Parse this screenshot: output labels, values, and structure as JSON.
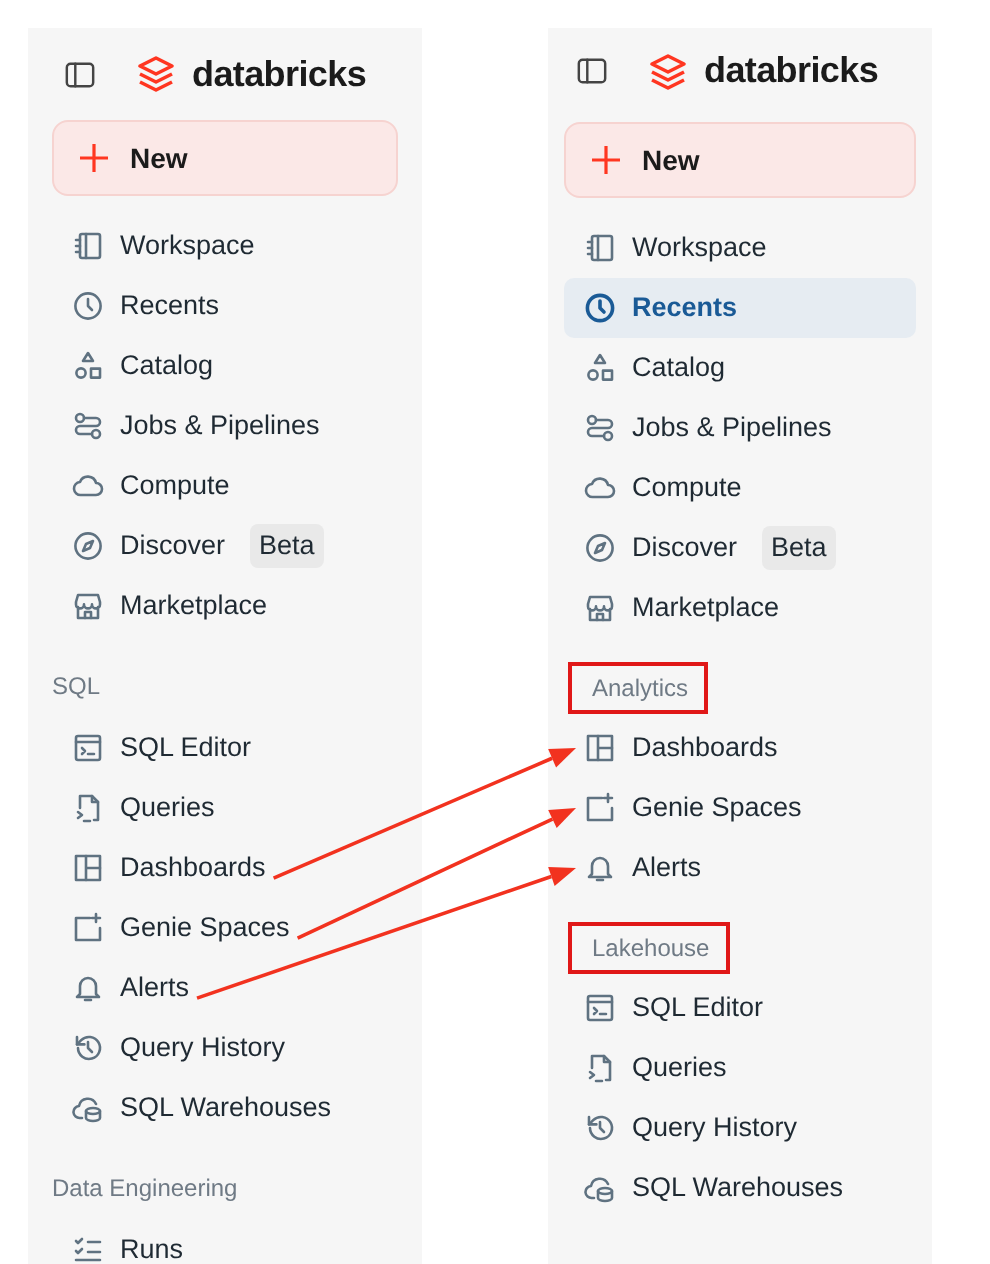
{
  "panels": [
    {
      "logo": "databricks",
      "new_button": "New",
      "sections": [
        {
          "items": [
            {
              "kind": "workspace",
              "label": "Workspace",
              "selected": false
            },
            {
              "kind": "clock",
              "label": "Recents",
              "selected": false
            },
            {
              "kind": "catalog",
              "label": "Catalog",
              "selected": false
            },
            {
              "kind": "jobs",
              "label": "Jobs & Pipelines",
              "selected": false
            },
            {
              "kind": "cloud",
              "label": "Compute",
              "selected": false
            },
            {
              "kind": "compass",
              "label": "Discover",
              "badge": "Beta",
              "selected": false
            },
            {
              "kind": "store",
              "label": "Marketplace",
              "selected": false
            }
          ]
        },
        {
          "title": "SQL",
          "highlighted": false,
          "items": [
            {
              "kind": "editor",
              "label": "SQL Editor",
              "selected": false,
              "arrow_out": false
            },
            {
              "kind": "query",
              "label": "Queries",
              "selected": false,
              "arrow_out": false
            },
            {
              "kind": "dashboard",
              "label": "Dashboards",
              "selected": false,
              "arrow_out": true
            },
            {
              "kind": "genie",
              "label": "Genie Spaces",
              "selected": false,
              "arrow_out": true
            },
            {
              "kind": "bell",
              "label": "Alerts",
              "selected": false,
              "arrow_out": true
            },
            {
              "kind": "history",
              "label": "Query History",
              "selected": false,
              "arrow_out": false
            },
            {
              "kind": "warehouse",
              "label": "SQL Warehouses",
              "selected": false,
              "arrow_out": false
            }
          ]
        },
        {
          "title": "Data Engineering",
          "highlighted": false,
          "items": [
            {
              "kind": "runs",
              "label": "Runs",
              "selected": false
            }
          ]
        }
      ]
    },
    {
      "logo": "databricks",
      "new_button": "New",
      "sections": [
        {
          "items": [
            {
              "kind": "workspace",
              "label": "Workspace",
              "selected": false
            },
            {
              "kind": "clock",
              "label": "Recents",
              "selected": true
            },
            {
              "kind": "catalog",
              "label": "Catalog",
              "selected": false
            },
            {
              "kind": "jobs",
              "label": "Jobs & Pipelines",
              "selected": false
            },
            {
              "kind": "cloud",
              "label": "Compute",
              "selected": false
            },
            {
              "kind": "compass",
              "label": "Discover",
              "badge": "Beta",
              "selected": false
            },
            {
              "kind": "store",
              "label": "Marketplace",
              "selected": false
            }
          ]
        },
        {
          "title": "Analytics",
          "highlighted": true,
          "items": [
            {
              "kind": "dashboard",
              "label": "Dashboards",
              "selected": false,
              "arrow_in": true
            },
            {
              "kind": "genie",
              "label": "Genie Spaces",
              "selected": false,
              "arrow_in": true
            },
            {
              "kind": "bell",
              "label": "Alerts",
              "selected": false,
              "arrow_in": true
            }
          ]
        },
        {
          "title": "Lakehouse",
          "highlighted": true,
          "items": [
            {
              "kind": "editor",
              "label": "SQL Editor",
              "selected": false
            },
            {
              "kind": "query",
              "label": "Queries",
              "selected": false
            },
            {
              "kind": "history",
              "label": "Query History",
              "selected": false
            },
            {
              "kind": "warehouse",
              "label": "SQL Warehouses",
              "selected": false
            }
          ]
        }
      ]
    }
  ]
}
